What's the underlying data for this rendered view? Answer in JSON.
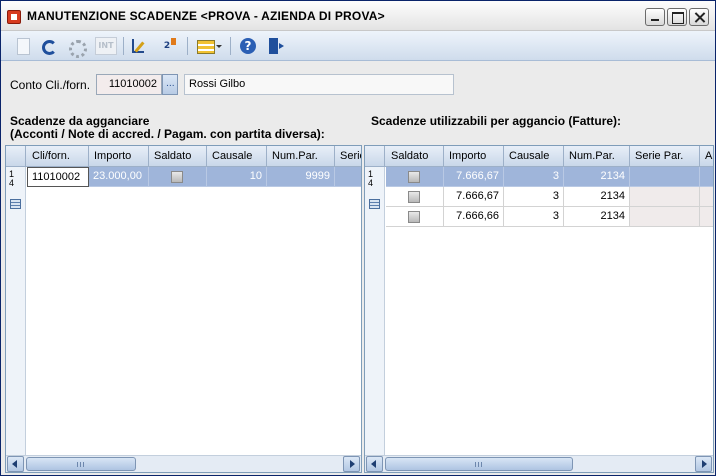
{
  "window": {
    "title": "MANUTENZIONE SCADENZE <PROVA - AZIENDA DI PROVA>"
  },
  "toolbar": {
    "items": [
      {
        "icon": "new-document-icon",
        "enabled": false
      },
      {
        "icon": "refresh-icon",
        "enabled": true
      },
      {
        "icon": "gear-icon",
        "enabled": false
      },
      {
        "icon": "int-icon",
        "label": "INT",
        "enabled": false
      },
      {
        "icon": "edit-pen-icon",
        "enabled": true
      },
      {
        "icon": "numbering-icon",
        "label": "2",
        "enabled": true
      },
      {
        "icon": "list-options-icon",
        "enabled": true
      },
      {
        "icon": "help-icon",
        "enabled": true
      },
      {
        "icon": "exit-door-icon",
        "enabled": true
      }
    ]
  },
  "form": {
    "conto_label": "Conto Cli./forn.",
    "conto_value": "11010002",
    "conto_lookup_label": "...",
    "name_value": "Rossi Gilbo"
  },
  "left": {
    "title_line1": "Scadenze da agganciare",
    "title_line2": "(Acconti / Note di accred. / Pagam. con partita diversa):",
    "columns": [
      "Cli/forn.",
      "Importo",
      "Saldato",
      "Causale",
      "Num.Par.",
      "Serie"
    ],
    "rows": [
      {
        "cli_forn": "11010002",
        "importo": "23.000,00",
        "saldato": false,
        "causale": "10",
        "num_par": "9999",
        "serie": ""
      }
    ],
    "row_indicator": "1\n4"
  },
  "right": {
    "title": "Scadenze utilizzabili per aggancio (Fatture):",
    "columns": [
      "Saldato",
      "Importo",
      "Causale",
      "Num.Par.",
      "Serie Par.",
      "A"
    ],
    "rows": [
      {
        "saldato": false,
        "importo": "7.666,67",
        "causale": "3",
        "num_par": "2134",
        "serie_par": "",
        "a": ""
      },
      {
        "saldato": false,
        "importo": "7.666,67",
        "causale": "3",
        "num_par": "2134",
        "serie_par": "",
        "a": ""
      },
      {
        "saldato": false,
        "importo": "7.666,66",
        "causale": "3",
        "num_par": "2134",
        "serie_par": "",
        "a": ""
      }
    ],
    "row_indicator": "1\n4"
  },
  "colors": {
    "selection": "#9fb5da",
    "window_border": "#0a246a",
    "grid_border": "#7f9db9"
  }
}
